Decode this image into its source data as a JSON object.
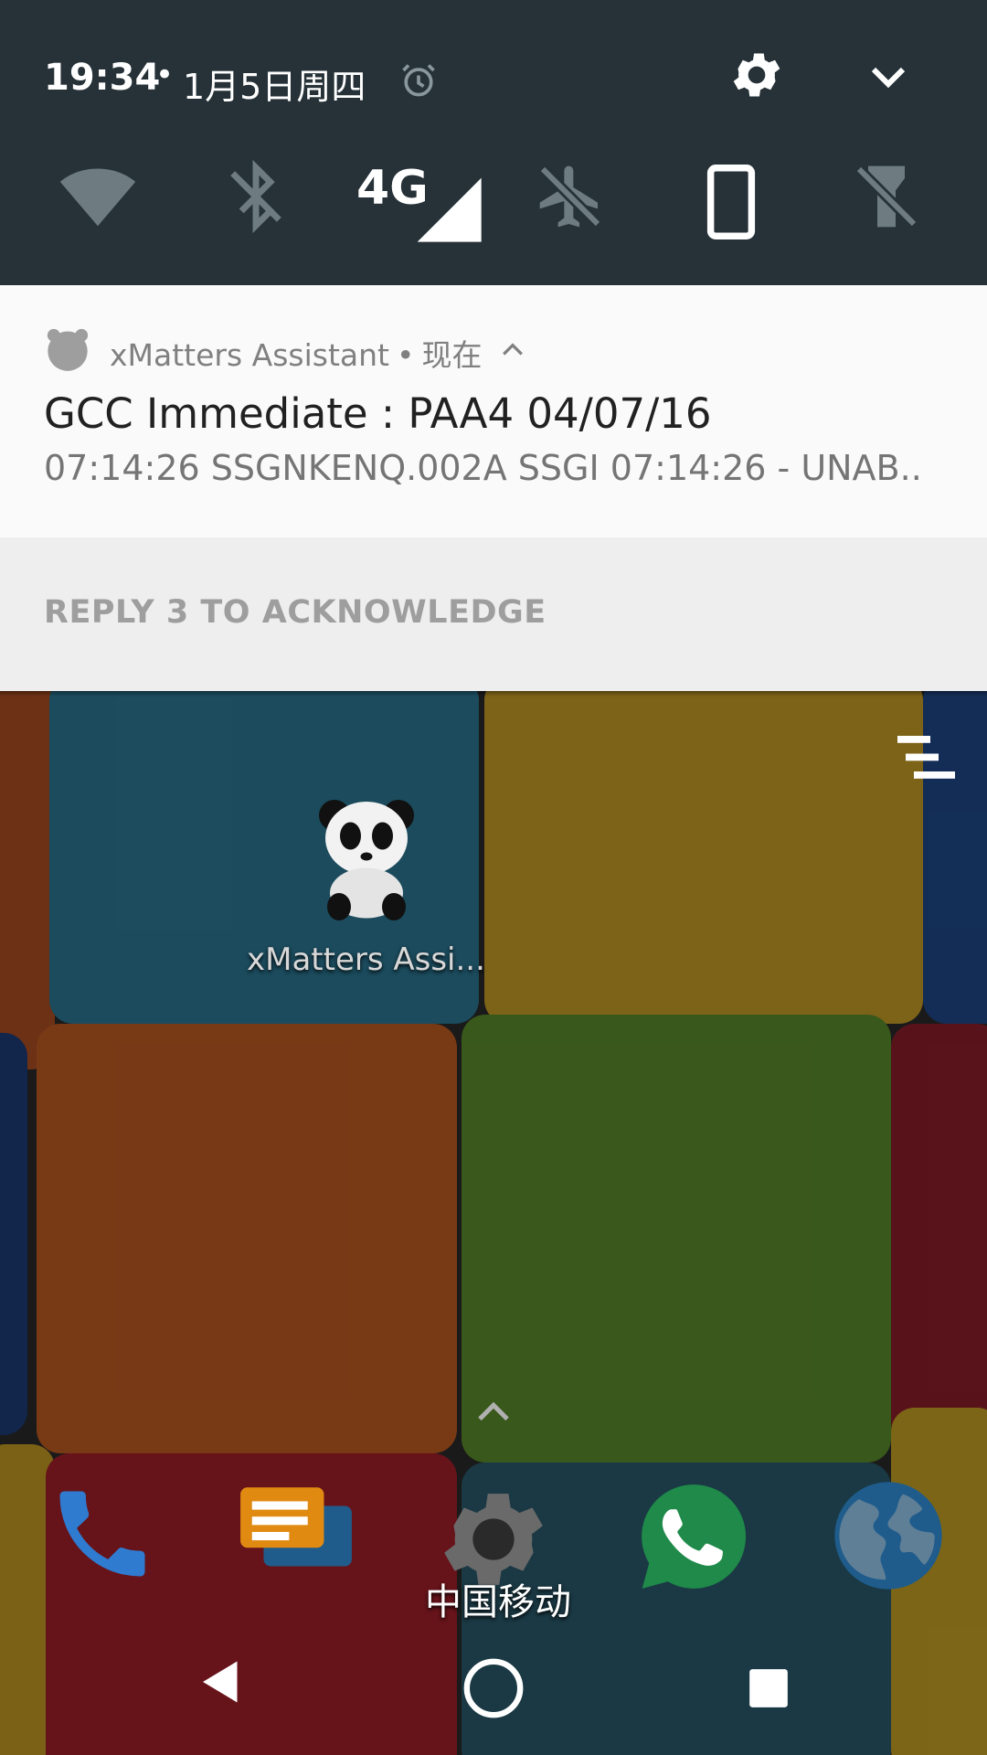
{
  "status": {
    "time": "19:34",
    "separator": "•",
    "date": "1月5日周四"
  },
  "quick_tiles": [
    {
      "name": "wifi",
      "icon": "wifi-icon"
    },
    {
      "name": "bluetooth",
      "icon": "bluetooth-off-icon"
    },
    {
      "name": "mobile-data",
      "icon": "signal-4g-icon",
      "label": "4G"
    },
    {
      "name": "airplane",
      "icon": "airplane-off-icon"
    },
    {
      "name": "rotation",
      "icon": "phone-portrait-icon"
    },
    {
      "name": "flashlight",
      "icon": "flashlight-off-icon"
    }
  ],
  "notification": {
    "app_name": "xMatters Assistant",
    "separator": "•",
    "time": "现在",
    "title": "GCC Immediate : PAA4 04/07/16",
    "body": "07:14:26 SSGNKENQ.002A SSGI 07:14:26 - UNAB..",
    "action": "REPLY 3 TO ACKNOWLEDGE"
  },
  "home": {
    "app_label": "xMatters Assi...",
    "carrier": "中国移动",
    "dock": [
      {
        "icon": "phone-icon"
      },
      {
        "icon": "messages-icon"
      },
      {
        "icon": "settings-app-icon"
      },
      {
        "icon": "whatsapp-icon"
      },
      {
        "icon": "browser-globe-icon"
      }
    ]
  },
  "colors": {
    "qs_background": "#263238",
    "notification_background": "#fafafa",
    "action_bar_background": "#eeeeee",
    "accent_blue": "#2e7bd0",
    "whatsapp_green": "#25d366"
  }
}
